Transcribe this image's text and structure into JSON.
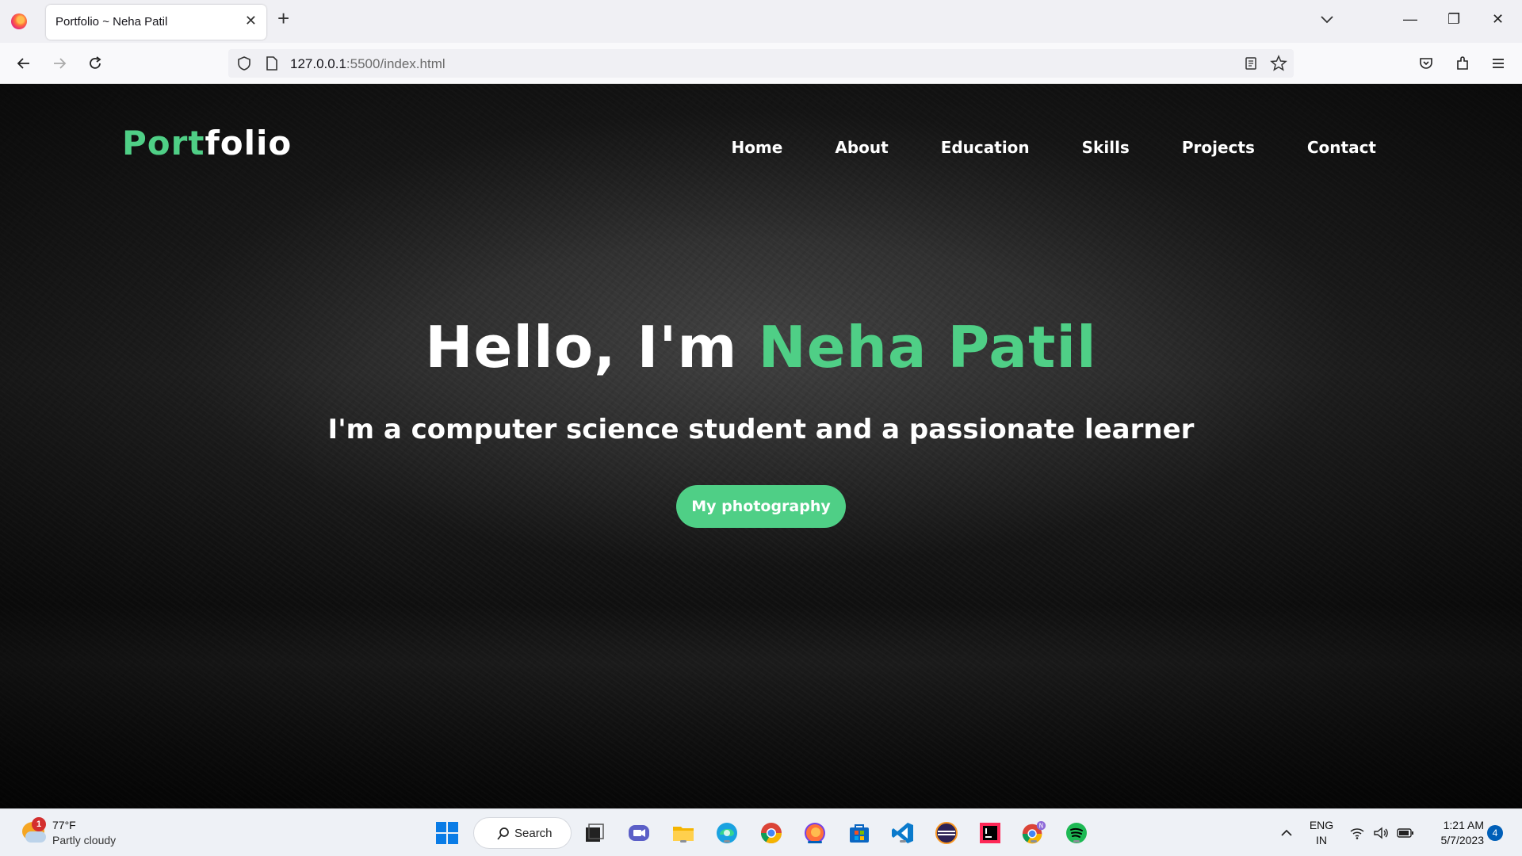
{
  "browser": {
    "tab_title": "Portfolio ~ Neha Patil",
    "url_host": "127.0.0.1",
    "url_rest": ":5500/index.html"
  },
  "site": {
    "logo_accent": "Port",
    "logo_rest": "folio",
    "nav": [
      "Home",
      "About",
      "Education",
      "Skills",
      "Projects",
      "Contact"
    ],
    "hero_greeting": "Hello, I'm ",
    "hero_name": "Neha Patil",
    "hero_subtitle": "I'm a computer science student and a passionate learner",
    "cta_label": "My photography"
  },
  "taskbar": {
    "weather_badge": "1",
    "temperature": "77°F",
    "weather_desc": "Partly cloudy",
    "search_label": "Search",
    "lang_top": "ENG",
    "lang_bottom": "IN",
    "time": "1:21 AM",
    "date": "5/7/2023",
    "notification_count": "4"
  },
  "colors": {
    "accent": "#4fcf86",
    "taskbar_bg": "#eef1f6"
  }
}
